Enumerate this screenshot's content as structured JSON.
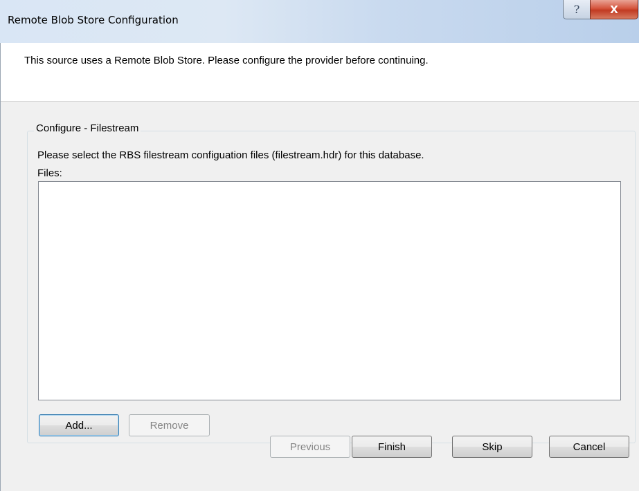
{
  "window": {
    "title": "Remote Blob Store Configuration",
    "help_glyph": "?",
    "close_glyph": "X"
  },
  "header": {
    "message": "This source uses a Remote Blob Store. Please configure the provider before continuing."
  },
  "configure": {
    "group_title": "Configure - Filestream",
    "instructions": "Please select the RBS filestream configuation files (filestream.hdr) for this database.",
    "files_label": "Files:",
    "files": [],
    "add_label": "Add...",
    "remove_label": "Remove"
  },
  "footer": {
    "previous_label": "Previous",
    "finish_label": "Finish",
    "skip_label": "Skip",
    "cancel_label": "Cancel"
  },
  "colors": {
    "title_gradient_left": "#d9e6f5",
    "title_gradient_right": "#b9cfea",
    "close_button": "#c13a22",
    "dialog_background": "#f0f0f0",
    "disabled_text": "#838383"
  }
}
